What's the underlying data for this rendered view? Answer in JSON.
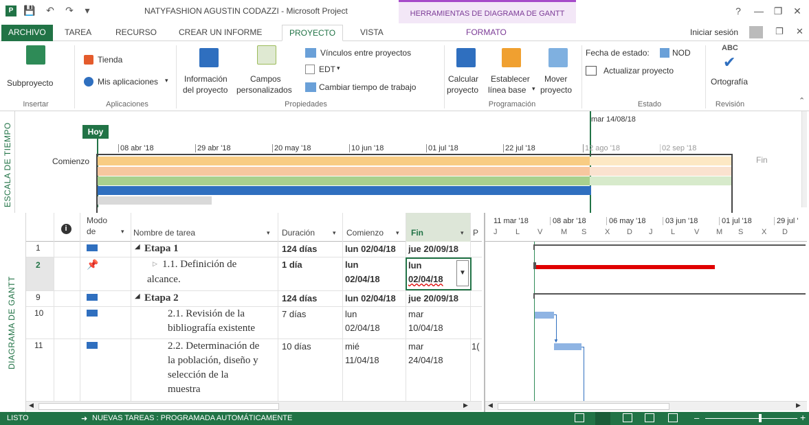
{
  "app": {
    "window_title": "NATYFASHION AGUSTIN CODAZZI - Microsoft Project",
    "contextual_tab_header": "HERRAMIENTAS DE DIAGRAMA DE GANTT",
    "sign_in": "Iniciar sesión",
    "help": "?"
  },
  "tabs": [
    "ARCHIVO",
    "TAREA",
    "RECURSO",
    "CREAR UN INFORME",
    "PROYECTO",
    "VISTA",
    "FORMATO"
  ],
  "ribbon": {
    "insertar": {
      "subproyecto": "Subproyecto",
      "label": "Insertar"
    },
    "aplicaciones": {
      "tienda": "Tienda",
      "mis_aplicaciones": "Mis aplicaciones",
      "label": "Aplicaciones"
    },
    "propiedades": {
      "info_line1": "Información",
      "info_line2": "del proyecto",
      "campos_line1": "Campos",
      "campos_line2": "personalizados",
      "vinculos": "Vínculos entre proyectos",
      "edt": "EDT",
      "cambiar_tiempo": "Cambiar tiempo de trabajo",
      "label": "Propiedades"
    },
    "programacion": {
      "calcular_line1": "Calcular",
      "calcular_line2": "proyecto",
      "establecer_line1": "Establecer",
      "establecer_line2": "línea base",
      "mover_line1": "Mover",
      "mover_line2": "proyecto",
      "label": "Programación"
    },
    "estado": {
      "fecha_estado_label": "Fecha de estado:",
      "fecha_estado_value": "NOD",
      "actualizar": "Actualizar proyecto",
      "label": "Estado"
    },
    "revision": {
      "ortografia": "Ortografía",
      "abc": "ABC",
      "label": "Revisión"
    }
  },
  "timeline": {
    "side_label": "ESCALA DE TIEMPO",
    "today": "Hoy",
    "start_label": "Comienzo",
    "end_label": "Fin",
    "status_date": "mar 14/08/18",
    "dates": [
      "08 abr '18",
      "29 abr '18",
      "20 may '18",
      "10 jun '18",
      "01 jul '18",
      "22 jul '18",
      "12 ago '18",
      "02 sep '18"
    ]
  },
  "grid": {
    "side_label": "DIAGRAMA DE GANTT",
    "columns": {
      "info": "i",
      "mode_line1": "Modo",
      "mode_line2": "de",
      "name": "Nombre de tarea",
      "duration": "Duración",
      "start": "Comienzo",
      "finish": "Fin",
      "extra": "P"
    },
    "rows": [
      {
        "id": "1",
        "name": "Etapa 1",
        "duration": "124 días",
        "start": "lun 02/04/18",
        "finish": "jue 20/09/18",
        "extra": ""
      },
      {
        "id": "2",
        "name_line1": "1.1. Definición de",
        "name_line2": "alcance.",
        "duration": "1 día",
        "start_line1": "lun",
        "start_line2": "02/04/18",
        "finish_line1": "lun",
        "finish_line2": "02/04/18",
        "extra": ""
      },
      {
        "id": "9",
        "name": "Etapa 2",
        "duration": "124 días",
        "start": "lun 02/04/18",
        "finish": "jue 20/09/18",
        "extra": ""
      },
      {
        "id": "10",
        "name_line1": "2.1. Revisión de la",
        "name_line2": "bibliografía existente",
        "duration": "7 días",
        "start_line1": "lun",
        "start_line2": "02/04/18",
        "finish_line1": "mar",
        "finish_line2": "10/04/18",
        "extra": ""
      },
      {
        "id": "11",
        "name_line1": "2.2. Determinación de",
        "name_line2": "la población, diseño y",
        "name_line3": "selección de la",
        "name_line4": "muestra",
        "duration": "10 días",
        "start_line1": "mié",
        "start_line2": "11/04/18",
        "finish_line1": "mar",
        "finish_line2": "24/04/18",
        "extra": "1("
      }
    ]
  },
  "chart": {
    "months": [
      "11 mar '18",
      "08 abr '18",
      "06 may '18",
      "03 jun '18",
      "01 jul '18",
      "29 jul '"
    ],
    "days": [
      "J",
      "L",
      "V",
      "M",
      "S",
      "X",
      "D",
      "J",
      "L",
      "V",
      "M",
      "S",
      "X",
      "D"
    ]
  },
  "status": {
    "ready": "LISTO",
    "new_tasks": "NUEVAS TAREAS : PROGRAMADA AUTOMÁTICAMENTE"
  },
  "colors": {
    "accent": "#217346",
    "critical": "#e00000",
    "bar": "#8fb4e3",
    "contextual": "#a64ac9"
  }
}
